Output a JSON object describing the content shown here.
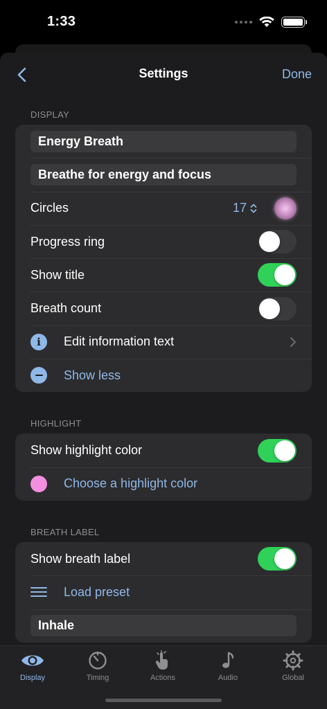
{
  "status": {
    "time": "1:33"
  },
  "nav": {
    "title": "Settings",
    "done_label": "Done"
  },
  "display": {
    "header": "DISPLAY",
    "name_value": "Energy Breath",
    "description_value": "Breathe for energy and focus",
    "circles_label": "Circles",
    "circles_value": "17",
    "progress_ring_label": "Progress ring",
    "progress_ring_on": false,
    "show_title_label": "Show title",
    "show_title_on": true,
    "breath_count_label": "Breath count",
    "breath_count_on": false,
    "edit_info_label": "Edit information text",
    "show_less_label": "Show less"
  },
  "highlight": {
    "header": "HIGHLIGHT",
    "show_label": "Show highlight color",
    "show_on": true,
    "choose_label": "Choose a highlight color",
    "color": "#f48fe0"
  },
  "breath_label": {
    "header": "BREATH LABEL",
    "show_label": "Show breath label",
    "show_on": true,
    "load_preset_label": "Load preset",
    "inhale_value": "Inhale"
  },
  "tabs": [
    {
      "label": "Display",
      "icon": "eye-icon",
      "active": true
    },
    {
      "label": "Timing",
      "icon": "timer-icon",
      "active": false
    },
    {
      "label": "Actions",
      "icon": "tap-hand-icon",
      "active": false
    },
    {
      "label": "Audio",
      "icon": "music-note-icon",
      "active": false
    },
    {
      "label": "Global",
      "icon": "gear-icon",
      "active": false
    }
  ],
  "colors": {
    "accent": "#8fb8e8",
    "toggle_on": "#30d158",
    "background": "#1c1c1e",
    "cell": "#2c2c2e"
  }
}
